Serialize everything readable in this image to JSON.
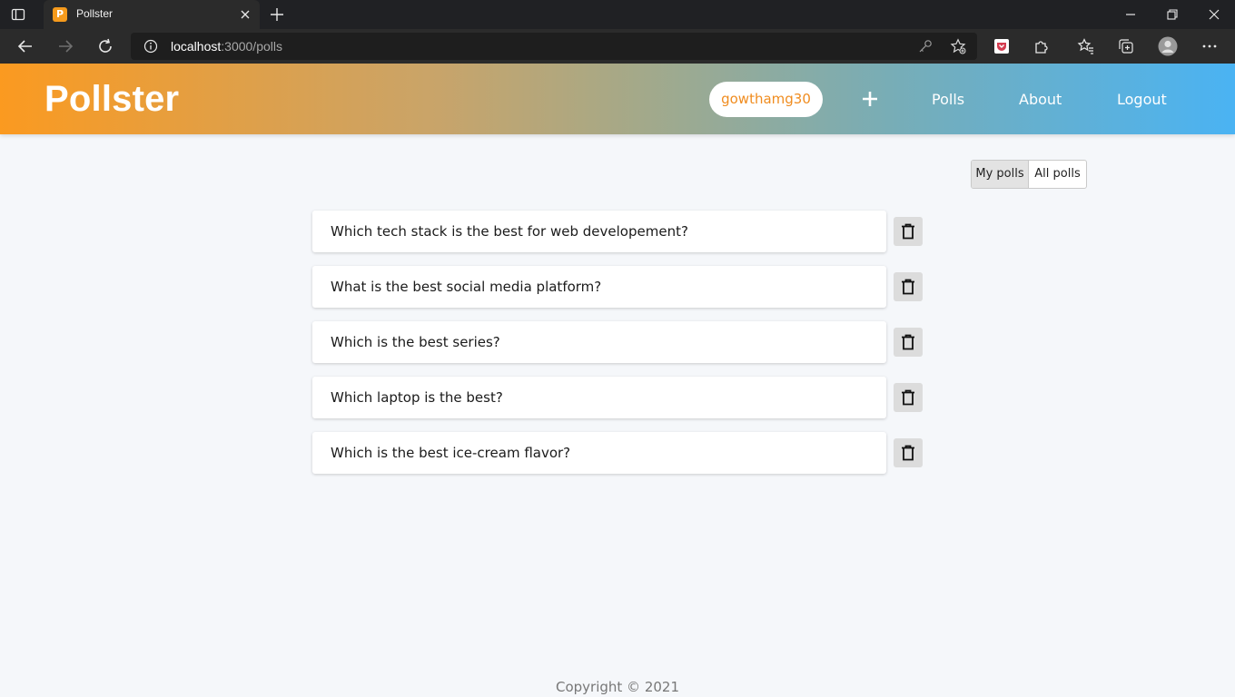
{
  "browser": {
    "tab_title": "Pollster",
    "url_host": "localhost",
    "url_path": ":3000/polls"
  },
  "header": {
    "brand": "Pollster",
    "username": "gowthamg30",
    "nav": {
      "polls": "Polls",
      "about": "About",
      "logout": "Logout"
    }
  },
  "filters": {
    "my_polls": "My polls",
    "all_polls": "All polls",
    "active": "My polls"
  },
  "polls": [
    {
      "question": "Which tech stack is the best for web developement?"
    },
    {
      "question": "What is the best social media platform?"
    },
    {
      "question": "Which is the best series?"
    },
    {
      "question": "Which laptop is the best?"
    },
    {
      "question": "Which is the best ice-cream flavor?"
    }
  ],
  "footer": {
    "copyright": "Copyright © 2021"
  },
  "colors": {
    "brand_orange": "#fb9a20",
    "brand_blue": "#4ab3f3",
    "username_text": "#f08c1f"
  }
}
